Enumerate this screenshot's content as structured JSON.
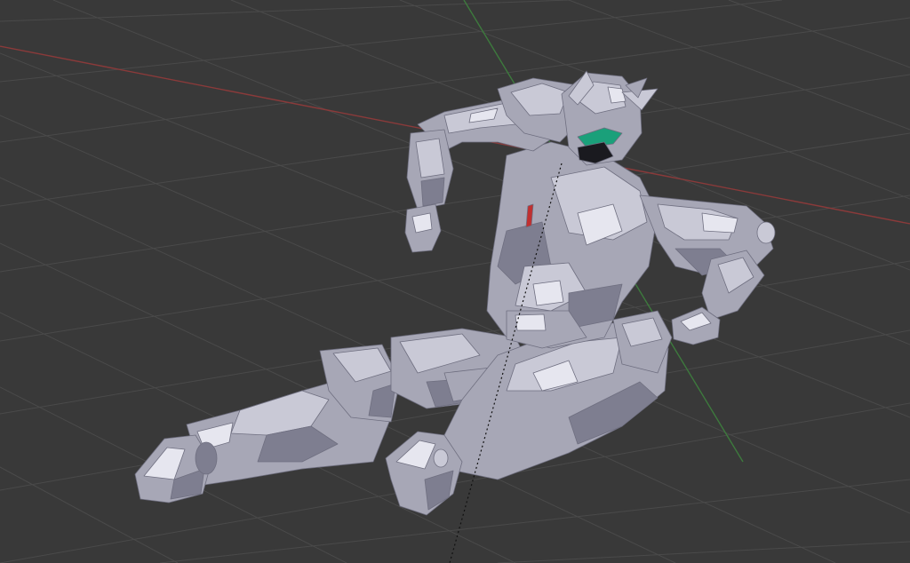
{
  "viewport": {
    "background": "#393939",
    "grid_color": "#4a4a4a",
    "x_axis_color": "#8a3a3a",
    "y_axis_color": "#3d7a3d",
    "relationship_line_color": "#111111"
  },
  "model": {
    "base_color": "#a7a7b6",
    "light_color": "#c9c9d6",
    "highlight_color": "#e6e6ef",
    "shadow_color": "#7e7e90",
    "visor_color": "#1aa07a",
    "accent_color": "#c03030"
  }
}
